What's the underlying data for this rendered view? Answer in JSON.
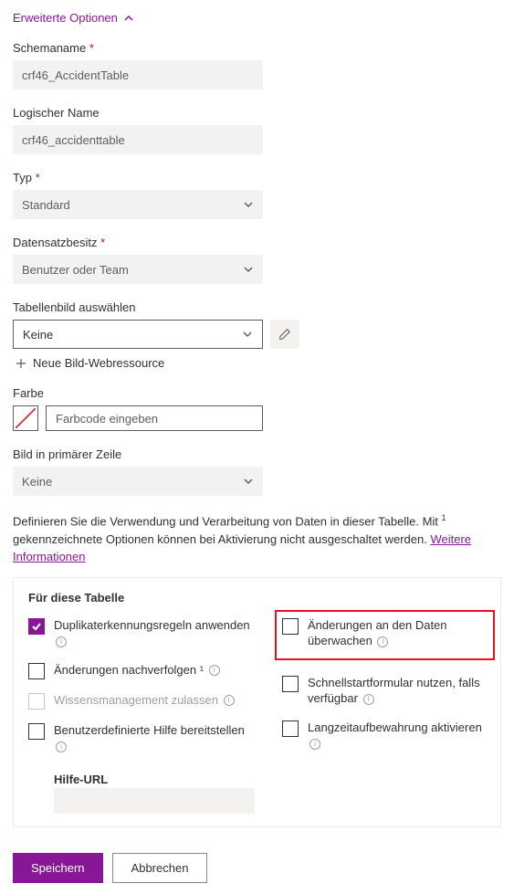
{
  "expand": {
    "label": "Erweiterte Optionen"
  },
  "fields": {
    "schema_name": {
      "label": "Schemaname",
      "value": "crf46_AccidentTable"
    },
    "logical_name": {
      "label": "Logischer Name",
      "value": "crf46_accidenttable"
    },
    "type": {
      "label": "Typ",
      "value": "Standard"
    },
    "ownership": {
      "label": "Datensatzbesitz",
      "value": "Benutzer oder Team"
    },
    "table_image": {
      "label": "Tabellenbild auswählen",
      "value": "Keine"
    },
    "new_image": {
      "label": "Neue Bild-Webressource"
    },
    "color": {
      "label": "Farbe",
      "placeholder": "Farbcode eingeben"
    },
    "primary_image": {
      "label": "Bild in primärer Zeile",
      "value": "Keine"
    }
  },
  "description": {
    "text1": "Definieren Sie die Verwendung und Verarbeitung von Daten in dieser Tabelle. Mit ",
    "text2": " gekennzeichnete Optionen können bei Aktivierung nicht ausgeschaltet werden. ",
    "link": "Weitere Informationen"
  },
  "panel": {
    "title": "Für diese Tabelle",
    "options": {
      "duplicate_detection": "Duplikaterkennungsregeln anwenden",
      "track_changes": "Änderungen nachverfolgen ¹",
      "knowledge": "Wissensmanagement zulassen",
      "custom_help": "Benutzerdefinierte Hilfe bereitstellen",
      "help_url": "Hilfe-URL",
      "audit_changes": "Änderungen an den Daten überwachen",
      "quick_create": "Schnellstartformular nutzen, falls verfügbar",
      "retention": "Langzeitaufbewahrung aktivieren"
    }
  },
  "buttons": {
    "save": "Speichern",
    "cancel": "Abbrechen"
  }
}
